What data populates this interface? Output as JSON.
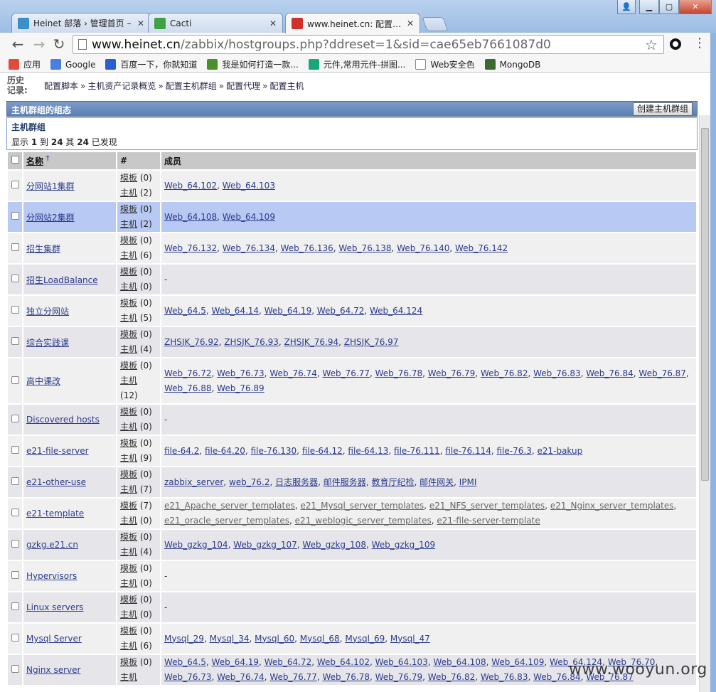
{
  "browser": {
    "tabs": [
      {
        "label": "Heinet 部落 › 管理首页 –",
        "icon_color": "#3a8fc9",
        "active": false
      },
      {
        "label": "Cacti",
        "icon_color": "#3fa245",
        "active": false
      },
      {
        "label": "www.heinet.cn: 配置主机",
        "icon_color": "#d0302a",
        "active": true
      }
    ],
    "url_host": "www.heinet.cn",
    "url_path": "/zabbix/hostgroups.php?ddreset=1&sid=cae65eb7661087d0",
    "bookmarks": [
      {
        "label": "应用",
        "icon": "apps-icon",
        "color": "#e24a3b"
      },
      {
        "label": "Google",
        "icon": "google-icon",
        "color": "#4a7fe0"
      },
      {
        "label": "百度一下，你就知道",
        "icon": "baidu-icon",
        "color": "#2a5fd0"
      },
      {
        "label": "我是如何打造一款...",
        "icon": "f-icon",
        "color": "#4a8f2a"
      },
      {
        "label": "元件,常用元件-拼图...",
        "icon": "p-icon",
        "color": "#1aa776"
      },
      {
        "label": "Web安全色",
        "icon": "page-icon",
        "color": "#ffffff"
      },
      {
        "label": "MongoDB",
        "icon": "mongodb-icon",
        "color": "#3d6b2f"
      }
    ]
  },
  "history": {
    "label": "历史记录:"
  },
  "breadcrumbs": [
    "配置脚本",
    "主机资产记录概览",
    "配置主机群组",
    "配置代理",
    "配置主机"
  ],
  "section": {
    "title": "主机群组的组态",
    "create_button": "创建主机群组"
  },
  "info": {
    "title": "主机群组",
    "prefix": "显示",
    "from": "1",
    "to_word": "到",
    "to": "24",
    "of_word": "其",
    "total": "24",
    "suffix": "已发现"
  },
  "table": {
    "headers": {
      "name": "名称",
      "count": "#",
      "members": "成员"
    },
    "rows": [
      {
        "name": "分网站1集群",
        "templates": "(0)",
        "hosts": "(2)",
        "members": [
          "Web_64.102",
          "Web_64.103"
        ]
      },
      {
        "name": "分网站2集群",
        "templates": "(0)",
        "hosts": "(2)",
        "members": [
          "Web_64.108",
          "Web_64.109"
        ],
        "highlight": true
      },
      {
        "name": "招生集群",
        "templates": "(0)",
        "hosts": "(6)",
        "members": [
          "Web_76.132",
          "Web_76.134",
          "Web_76.136",
          "Web_76.138",
          "Web_76.140",
          "Web_76.142"
        ]
      },
      {
        "name": "招生LoadBalance",
        "templates": "(0)",
        "hosts": "(0)",
        "members": [],
        "empty": "-"
      },
      {
        "name": "独立分网站",
        "templates": "(0)",
        "hosts": "(5)",
        "members": [
          "Web_64.5",
          "Web_64.14",
          "Web_64.19",
          "Web_64.72",
          "Web_64.124"
        ]
      },
      {
        "name": "综合实践课",
        "templates": "(0)",
        "hosts": "(4)",
        "members": [
          "ZHSJK_76.92",
          "ZHSJK_76.93",
          "ZHSJK_76.94",
          "ZHSJK_76.97"
        ]
      },
      {
        "name": "高中课改",
        "templates": "(0)",
        "hosts": "(12)",
        "members": [
          "Web_76.72",
          "Web_76.73",
          "Web_76.74",
          "Web_76.77",
          "Web_76.78",
          "Web_76.79",
          "Web_76.82",
          "Web_76.83",
          "Web_76.84",
          "Web_76.87",
          "Web_76.88",
          "Web_76.89"
        ]
      },
      {
        "name": "Discovered hosts",
        "templates": "(0)",
        "hosts": "(0)",
        "members": [],
        "empty": "-"
      },
      {
        "name": "e21-file-server",
        "templates": "(0)",
        "hosts": "(9)",
        "members": [
          "file-64.2",
          "file-64.20",
          "file-76.130",
          "file-64.12",
          "file-64.13",
          "file-76.111",
          "file-76.114",
          "file-76.3",
          "e21-bakup"
        ]
      },
      {
        "name": "e21-other-use",
        "templates": "(0)",
        "hosts": "(7)",
        "members": [
          "zabbix_server",
          "web_76.2",
          "日志服务器",
          "邮件服务器",
          "教育厅纪检",
          "邮件网关",
          "IPMI"
        ]
      },
      {
        "name": "e21-template",
        "templates": "(7)",
        "hosts": "(0)",
        "template_members": true,
        "members": [
          "e21_Apache_server_templates",
          "e21_Mysql_server_templates",
          "e21_NFS_server_templates",
          "e21_Nginx_server_templates",
          "e21_oracle_server_templates",
          "e21_weblogic_server_templates",
          "e21-file-server-template"
        ]
      },
      {
        "name": "gzkg.e21.cn",
        "templates": "(0)",
        "hosts": "(4)",
        "members": [
          "Web_gzkg_104",
          "Web_gzkg_107",
          "Web_gzkg_108",
          "Web_gzkg_109"
        ]
      },
      {
        "name": "Hypervisors",
        "templates": "(0)",
        "hosts": "(0)",
        "members": [],
        "empty": "-"
      },
      {
        "name": "Linux servers",
        "templates": "(0)",
        "hosts": "(0)",
        "members": [],
        "empty": "-"
      },
      {
        "name": "Mysql Server",
        "templates": "(0)",
        "hosts": "(6)",
        "members": [
          "Mysql_29",
          "Mysql_34",
          "Mysql_60",
          "Mysql_68",
          "Mysql_69",
          "Mysql_47"
        ]
      },
      {
        "name": "Nginx server",
        "templates": "(0)",
        "hosts": "",
        "members": [
          "Web_64.5",
          "Web_64.19",
          "Web_64.72",
          "Web_64.102",
          "Web_64.103",
          "Web_64.108",
          "Web_64.109",
          "Web_64.124",
          "Web_76.70",
          "Web_76.73",
          "Web_76.74",
          "Web_76.77",
          "Web_76.78",
          "Web_76.79",
          "Web_76.82",
          "Web_76.83",
          "Web_76.84",
          "Web_76.87"
        ]
      }
    ],
    "template_label": "模板",
    "host_label": "主机"
  },
  "watermark": "www.wooyun.org"
}
